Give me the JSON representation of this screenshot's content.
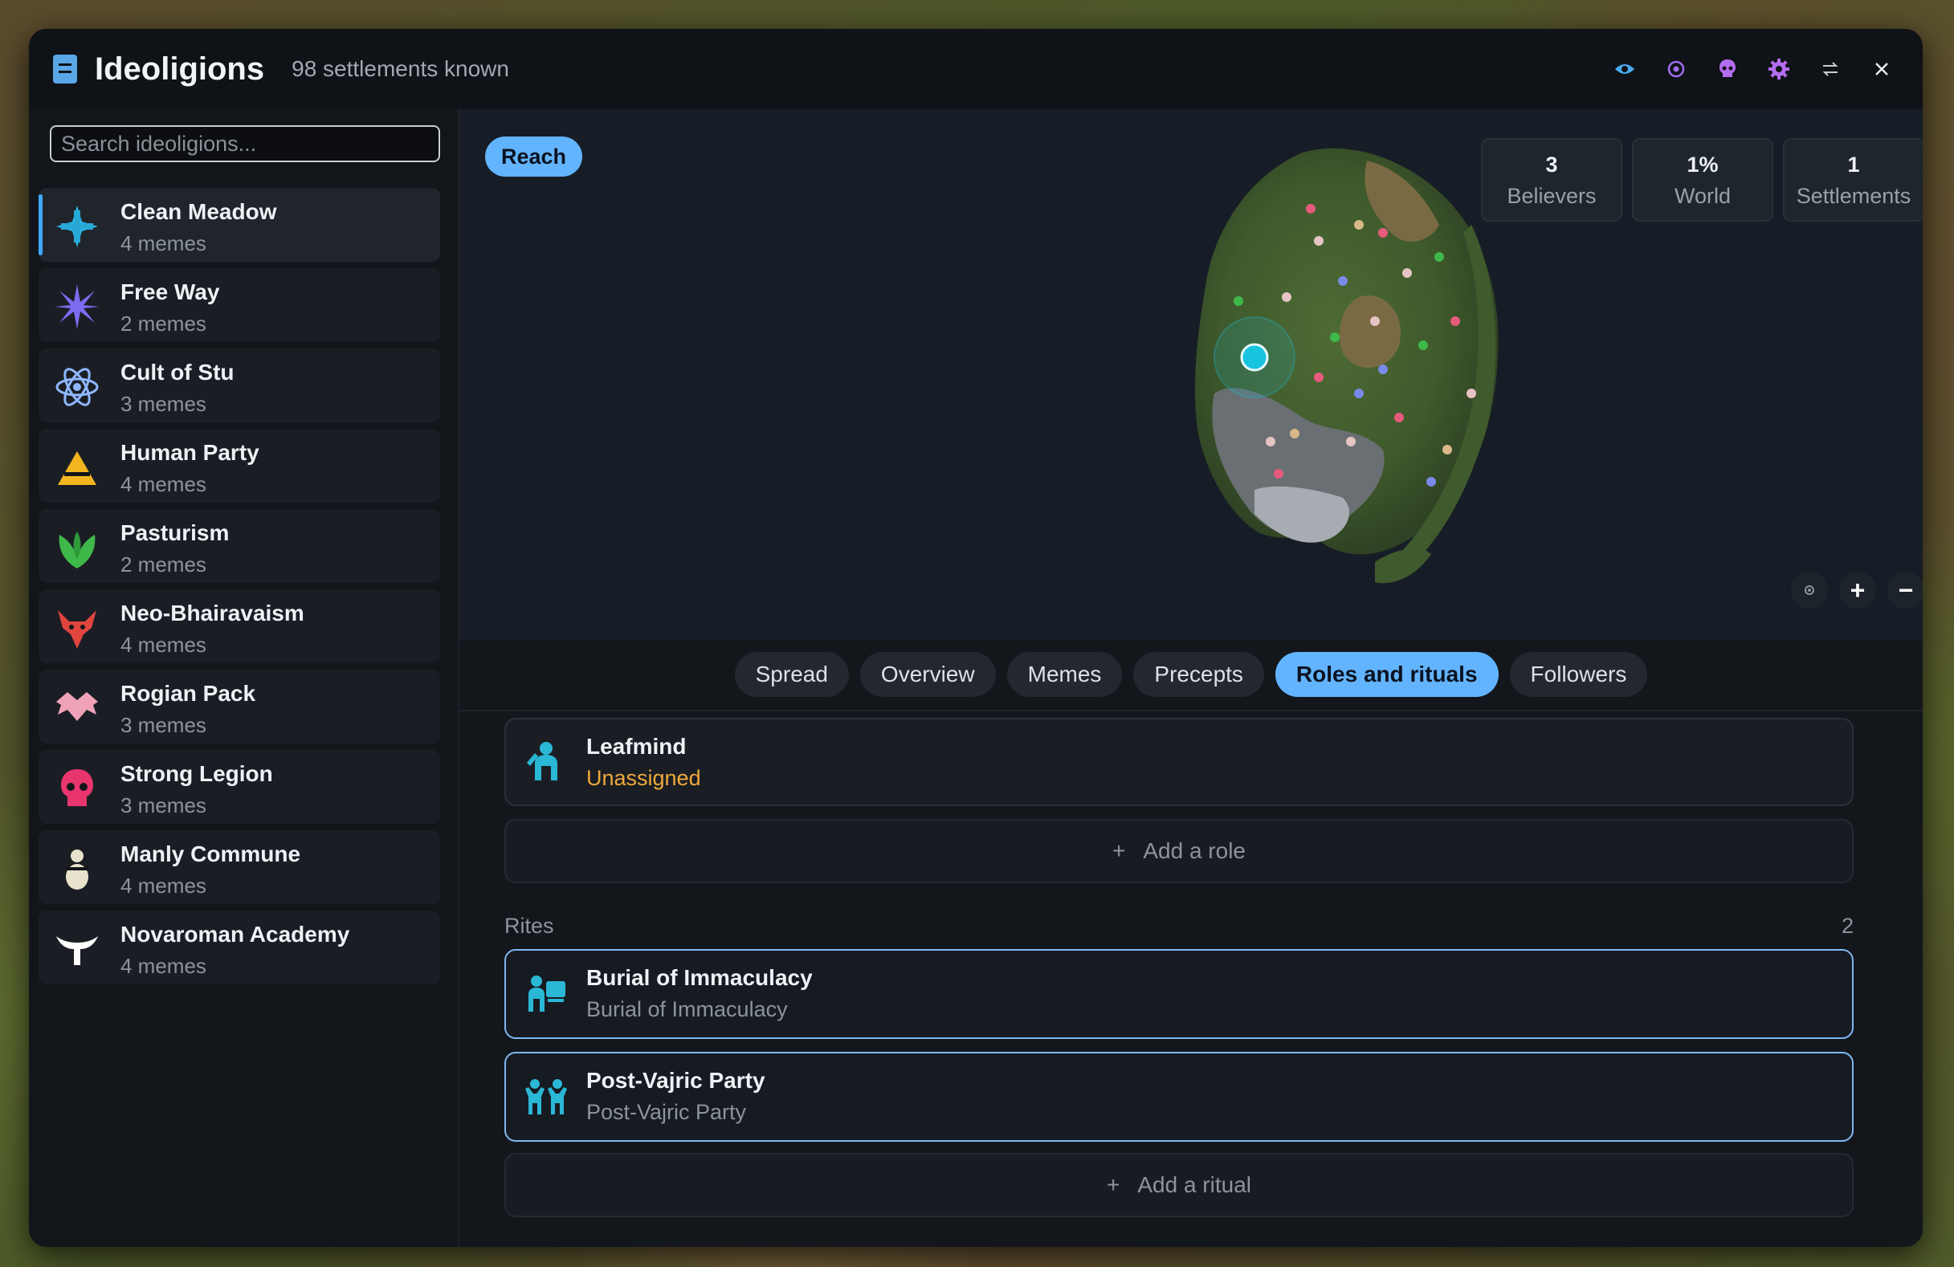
{
  "window": {
    "title": "Ideoligions",
    "subtitle": "98 settlements known",
    "title_icon": "book-icon",
    "toolbar_icons": [
      "eye-icon",
      "target-icon",
      "skull-icon",
      "gear-icon",
      "swap-icon",
      "close-icon"
    ],
    "accent_color": "#63b4ff"
  },
  "sidebar": {
    "search_placeholder": "Search ideoligions...",
    "items": [
      {
        "name": "Clean Meadow",
        "memes": "4 memes",
        "icon": "cross-icon",
        "color": "#2bb7e6"
      },
      {
        "name": "Free Way",
        "memes": "2 memes",
        "icon": "star-burst-icon",
        "color": "#7b6cf2"
      },
      {
        "name": "Cult of Stu",
        "memes": "3 memes",
        "icon": "atom-icon",
        "color": "#8fb6ff"
      },
      {
        "name": "Human Party",
        "memes": "4 memes",
        "icon": "triangle-icon",
        "color": "#f2b51f"
      },
      {
        "name": "Pasturism",
        "memes": "2 memes",
        "icon": "leaf-icon",
        "color": "#3fb84a"
      },
      {
        "name": "Neo-Bhairavaism",
        "memes": "4 memes",
        "icon": "horned-demon-icon",
        "color": "#e0453e"
      },
      {
        "name": "Rogian Pack",
        "memes": "3 memes",
        "icon": "wings-icon",
        "color": "#f0a3b8"
      },
      {
        "name": "Strong Legion",
        "memes": "3 memes",
        "icon": "skull-icon",
        "color": "#e8356e"
      },
      {
        "name": "Manly Commune",
        "memes": "4 memes",
        "icon": "figure-icon",
        "color": "#e8e2cc"
      },
      {
        "name": "Novaroman Academy",
        "memes": "4 memes",
        "icon": "bull-horns-icon",
        "color": "#ffffff"
      }
    ],
    "selected": "Clean Meadow"
  },
  "map": {
    "reach_label": "Reach",
    "stats": [
      {
        "value": "3",
        "label": "Believers"
      },
      {
        "value": "1%",
        "label": "World"
      },
      {
        "value": "1",
        "label": "Settlements"
      }
    ],
    "controls": [
      "recenter-icon",
      "zoom-in-icon",
      "zoom-out-icon"
    ],
    "control_glyphs": {
      "zoom_in": "+",
      "zoom_out": "−"
    }
  },
  "tabs": [
    "Spread",
    "Overview",
    "Memes",
    "Precepts",
    "Roles and rituals",
    "Followers"
  ],
  "active_tab": "Roles and rituals",
  "roles": {
    "items": [
      {
        "title": "Leafmind",
        "status": "Unassigned",
        "icon": "leader-icon"
      }
    ],
    "add_label": "Add a role"
  },
  "rites": {
    "header": "Rites",
    "count": "2",
    "items": [
      {
        "title": "Burial of Immaculacy",
        "subtitle": "Burial of Immaculacy",
        "icon": "funeral-icon"
      },
      {
        "title": "Post-Vajric Party",
        "subtitle": "Post-Vajric Party",
        "icon": "party-icon"
      }
    ],
    "add_label": "Add a ritual"
  },
  "plus_glyph": "+"
}
